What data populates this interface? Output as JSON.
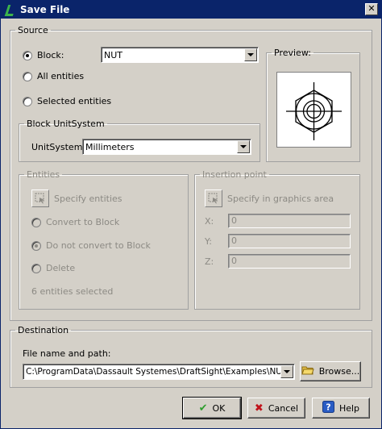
{
  "window": {
    "title": "Save File",
    "close_glyph": "✕"
  },
  "source": {
    "legend": "Source",
    "block_label": "Block:",
    "block_value": "NUT",
    "all_entities_label": "All entities",
    "selected_entities_label": "Selected entities",
    "selected_option": "block"
  },
  "preview": {
    "legend": "Preview:"
  },
  "unitsystem": {
    "legend": "Block UnitSystem",
    "label": "UnitSystem:",
    "value": "Millimeters"
  },
  "entities": {
    "legend": "Entities",
    "specify_label": "Specify entities",
    "convert_label": "Convert to Block",
    "no_convert_label": "Do not convert to Block",
    "delete_label": "Delete",
    "status": "6 entities selected"
  },
  "insertion": {
    "legend": "Insertion point",
    "specify_label": "Specify in graphics area",
    "x_label": "X:",
    "x_value": "0",
    "y_label": "Y:",
    "y_value": "0",
    "z_label": "Z:",
    "z_value": "0"
  },
  "destination": {
    "legend": "Destination",
    "path_label": "File name and path:",
    "path_value": "C:\\ProgramData\\Dassault Systemes\\DraftSight\\Examples\\NUT.dwg",
    "browse_label": "Browse..."
  },
  "buttons": {
    "ok": "OK",
    "cancel": "Cancel",
    "help": "Help"
  },
  "colors": {
    "titlebar": "#0a246a",
    "dialog": "#d4d0c8",
    "ok_check": "#2e9e2e",
    "cancel_x": "#c0141c",
    "help_blue": "#2a5cc4"
  }
}
